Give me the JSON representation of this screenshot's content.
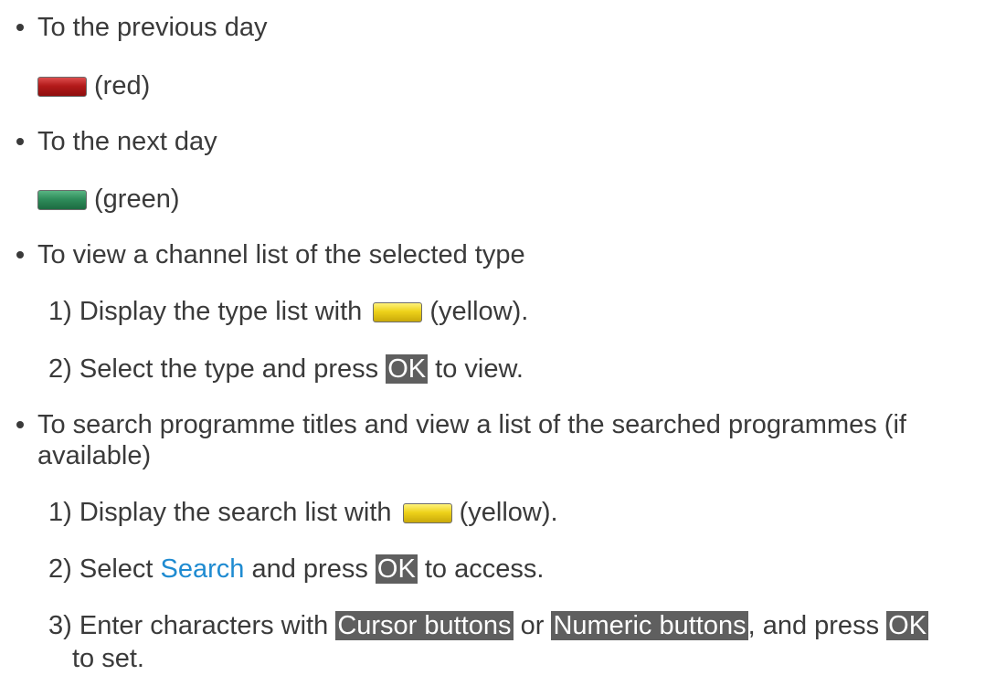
{
  "items": [
    {
      "text": "To the previous day",
      "button_label": "(red)",
      "button_color": "#b31a1a"
    },
    {
      "text": "To the next day",
      "button_label": "(green)",
      "button_color": "#2f8d5b"
    },
    {
      "text": "To view a channel list of the selected type",
      "steps": [
        {
          "num": "1)",
          "pre": "Display the type list with",
          "post": "(yellow)."
        },
        {
          "num": "2)",
          "pre": "Select the type and press",
          "key": "OK",
          "post": "to view."
        }
      ]
    },
    {
      "text_line1": "To search programme titles and view a list of the searched programmes (if",
      "text_line2": "available)",
      "steps": [
        {
          "num": "1)",
          "pre": "Display the search list with",
          "post": "(yellow)."
        },
        {
          "num": "2)",
          "pre": "Select",
          "link": "Search",
          "mid": "and press",
          "key": "OK",
          "post": "to access."
        },
        {
          "num": "3)",
          "pre": "Enter characters with",
          "key1": "Cursor buttons",
          "or": "or",
          "key2": "Numeric buttons",
          "comma_press": ", and press",
          "key3": "OK",
          "line2": "to set."
        }
      ]
    }
  ],
  "colors": {
    "text": "#3a3a3a",
    "link": "#1f8bd1",
    "key_bg": "#5f5f5f",
    "yellow": "#eed21a"
  }
}
